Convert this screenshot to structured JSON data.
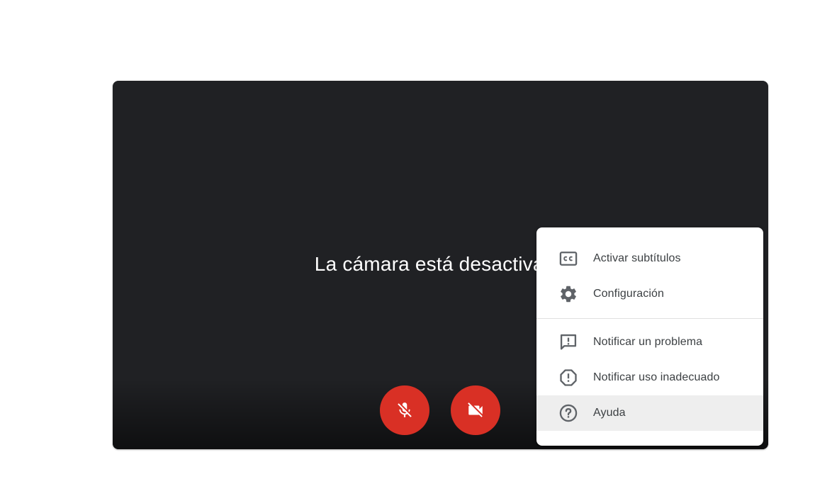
{
  "preview": {
    "camera_off_text": "La cámara está desactivada",
    "background_color": "#202124"
  },
  "controls": {
    "mic": {
      "icon": "mic-off-icon",
      "state": "off"
    },
    "camera": {
      "icon": "videocam-off-icon",
      "state": "off"
    },
    "button_color": "#d93025"
  },
  "menu": {
    "items": [
      {
        "label": "Activar subtítulos",
        "icon": "closed-captions-icon"
      },
      {
        "label": "Configuración",
        "icon": "gear-icon"
      },
      {
        "label": "Notificar un problema",
        "icon": "feedback-icon"
      },
      {
        "label": "Notificar uso inadecuado",
        "icon": "report-icon"
      },
      {
        "label": "Ayuda",
        "icon": "help-icon"
      }
    ]
  }
}
